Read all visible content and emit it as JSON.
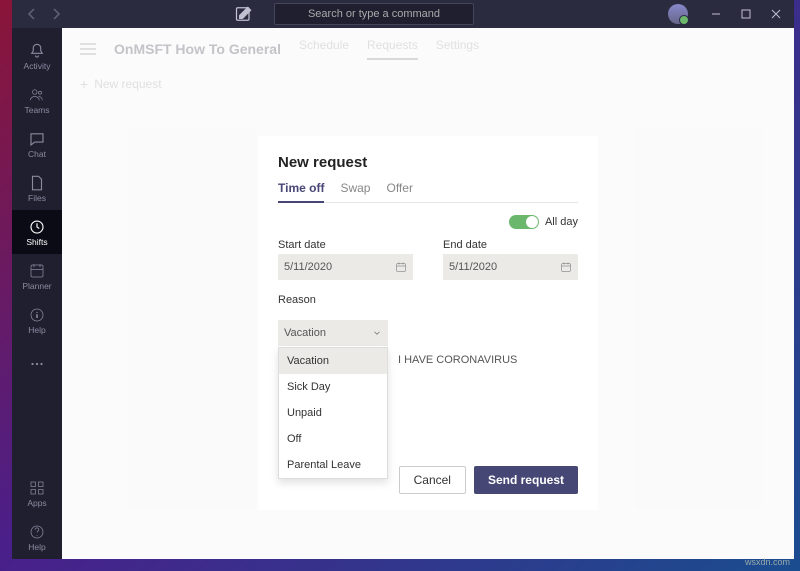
{
  "titlebar": {
    "search_placeholder": "Search or type a command"
  },
  "rail": {
    "items": [
      {
        "label": "Activity"
      },
      {
        "label": "Teams"
      },
      {
        "label": "Chat"
      },
      {
        "label": "Files"
      },
      {
        "label": "Shifts"
      },
      {
        "label": "Planner"
      },
      {
        "label": "Help"
      }
    ],
    "bottom": [
      {
        "label": "Apps"
      },
      {
        "label": "Help"
      }
    ]
  },
  "header": {
    "team": "OnMSFT How To General",
    "tabs": [
      "Schedule",
      "Requests",
      "Settings"
    ],
    "new_request": "New request"
  },
  "dialog": {
    "title": "New request",
    "tabs": [
      "Time off",
      "Swap",
      "Offer"
    ],
    "allday_label": "All day",
    "start_label": "Start date",
    "start_value": "5/11/2020",
    "end_label": "End date",
    "end_value": "5/11/2020",
    "reason_label": "Reason",
    "reason_value": "Vacation",
    "reason_options": [
      "Vacation",
      "Sick Day",
      "Unpaid",
      "Off",
      "Parental Leave"
    ],
    "note_value": "I HAVE CORONAVIRUS",
    "cancel": "Cancel",
    "send": "Send request"
  },
  "watermark": "wsxdn.com"
}
